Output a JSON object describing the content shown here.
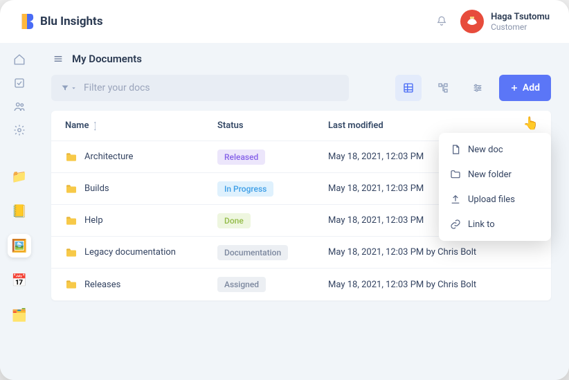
{
  "brand": "Blu Insights",
  "user": {
    "name": "Haga Tsutomu",
    "role": "Customer"
  },
  "page": {
    "title": "My Documents"
  },
  "filter": {
    "placeholder": "Filter your docs"
  },
  "add_button": "Add",
  "table": {
    "headers": {
      "name": "Name",
      "status": "Status",
      "modified": "Last modified"
    },
    "rows": [
      {
        "name": "Architecture",
        "status": "Released",
        "status_class": "chip-released",
        "modified": "May 18, 2021, 12:03 PM"
      },
      {
        "name": "Builds",
        "status": "In Progress",
        "status_class": "chip-inprogress",
        "modified": "May 18, 2021, 12:03 PM"
      },
      {
        "name": "Help",
        "status": "Done",
        "status_class": "chip-done",
        "modified": "May 18, 2021, 12:03 PM"
      },
      {
        "name": "Legacy documentation",
        "status": "Documentation",
        "status_class": "chip-documentation",
        "modified": "May 18, 2021, 12:03 PM by Chris Bolt"
      },
      {
        "name": "Releases",
        "status": "Assigned",
        "status_class": "chip-assigned",
        "modified": "May 18, 2021, 12:03 PM by Chris Bolt"
      }
    ]
  },
  "dropdown": [
    {
      "label": "New doc",
      "icon": "doc"
    },
    {
      "label": "New folder",
      "icon": "folder"
    },
    {
      "label": "Upload files",
      "icon": "upload"
    },
    {
      "label": "Link to",
      "icon": "link"
    }
  ]
}
